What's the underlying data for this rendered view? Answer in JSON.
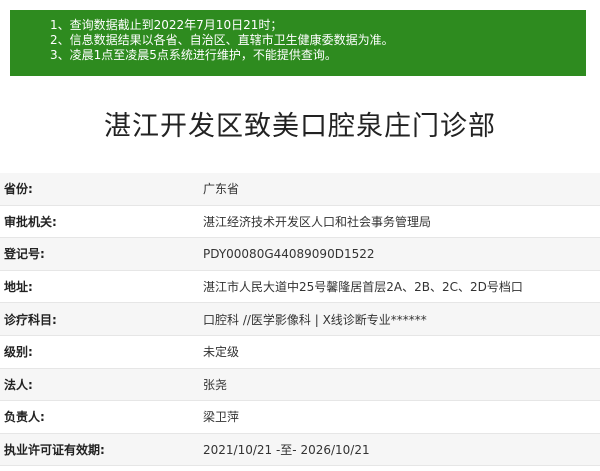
{
  "notice": {
    "lines": [
      "1、查询数据截止到2022年7月10日21时；",
      "2、信息数据结果以各省、自治区、直辖市卫生健康委数据为准。",
      "3、凌晨1点至凌晨5点系统进行维护，不能提供查询。"
    ]
  },
  "title": "湛江开发区致美口腔泉庄门诊部",
  "rows": [
    {
      "label": "省份:",
      "value": "广东省"
    },
    {
      "label": "审批机关:",
      "value": "湛江经济技术开发区人口和社会事务管理局"
    },
    {
      "label": "登记号:",
      "value": "PDY00080G44089090D1522"
    },
    {
      "label": "地址:",
      "value": "湛江市人民大道中25号馨隆居首层2A、2B、2C、2D号档口"
    },
    {
      "label": "诊疗科目:",
      "value": "口腔科 //医学影像科 | X线诊断专业******"
    },
    {
      "label": "级别:",
      "value": "未定级"
    },
    {
      "label": "法人:",
      "value": "张尧"
    },
    {
      "label": "负责人:",
      "value": "梁卫萍"
    },
    {
      "label": "执业许可证有效期:",
      "value": "2021/10/21 -至- 2026/10/21"
    }
  ],
  "colors": {
    "notice_bg": "#2e8b1f",
    "row_alt": "#f6f6f6"
  }
}
